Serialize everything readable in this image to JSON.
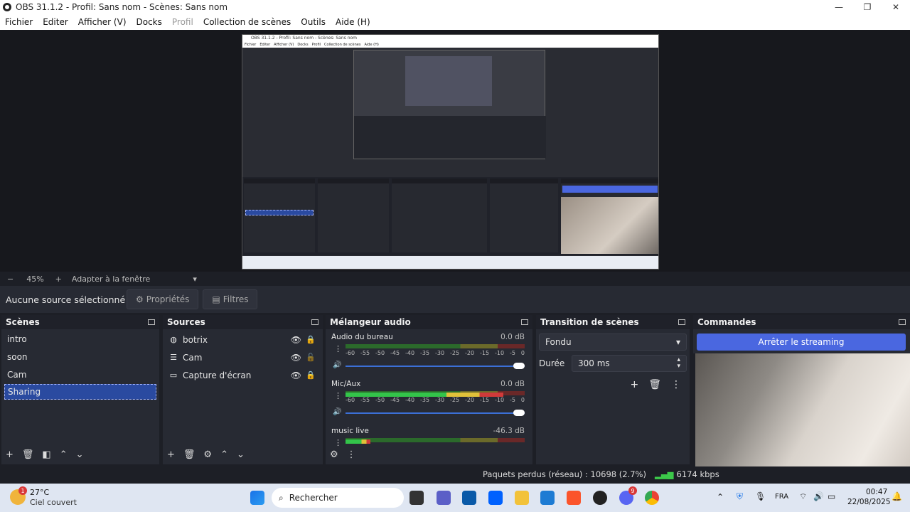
{
  "window": {
    "title": "OBS 31.1.2 - Profil: Sans nom - Scènes: Sans nom",
    "min": "—",
    "max": "❐",
    "close": "✕"
  },
  "menu": {
    "items": [
      "Fichier",
      "Editer",
      "Afficher (V)",
      "Docks",
      "Profil",
      "Collection de scènes",
      "Outils",
      "Aide (H)"
    ]
  },
  "zoom": {
    "minus": "−",
    "value": "45%",
    "plus": "+",
    "fit": "Adapter à la fenêtre"
  },
  "source_bar": {
    "none_selected": "Aucune source sélectionné",
    "properties": "Propriétés",
    "filters": "Filtres"
  },
  "scenes": {
    "title": "Scènes",
    "items": [
      "intro",
      "soon",
      "Cam",
      "Sharing"
    ],
    "selected": "Sharing"
  },
  "sources": {
    "title": "Sources",
    "items": [
      "botrix",
      "Cam",
      "Capture d'écran"
    ]
  },
  "mixer": {
    "title": "Mélangeur audio",
    "ticks": [
      "-60",
      "-55",
      "-50",
      "-45",
      "-40",
      "-35",
      "-30",
      "-25",
      "-20",
      "-15",
      "-10",
      "-5",
      "0"
    ],
    "tracks": [
      {
        "name": "Audio du bureau",
        "db": "0.0 dB",
        "level": 0
      },
      {
        "name": "Mic/Aux",
        "db": "0.0 dB",
        "level": 0.88
      },
      {
        "name": "music live",
        "db": "-46.3 dB",
        "level": 0.14
      }
    ]
  },
  "transition": {
    "title": "Transition de scènes",
    "type": "Fondu",
    "duration_label": "Durée",
    "duration": "300 ms"
  },
  "commands": {
    "title": "Commandes",
    "stop_streaming": "Arrêter le streaming"
  },
  "status": {
    "dropped": "Paquets perdus (réseau) : 10698 (2.7%)",
    "bitrate": "6174 kbps"
  },
  "taskbar": {
    "weather_temp": "27°C",
    "weather_desc": "Ciel couvert",
    "weather_badge": "1",
    "search": "Rechercher",
    "discord_badge": "9",
    "lang": "FRA",
    "time": "00:47",
    "date": "22/08/2025"
  },
  "preview_menu": [
    "Fichier",
    "Editer",
    "Afficher (V)",
    "Docks",
    "Profil",
    "Collection de scènes",
    "Aide (H)"
  ],
  "colors": {
    "accent": "#4a67e0",
    "selected": "#2a4aa0"
  }
}
